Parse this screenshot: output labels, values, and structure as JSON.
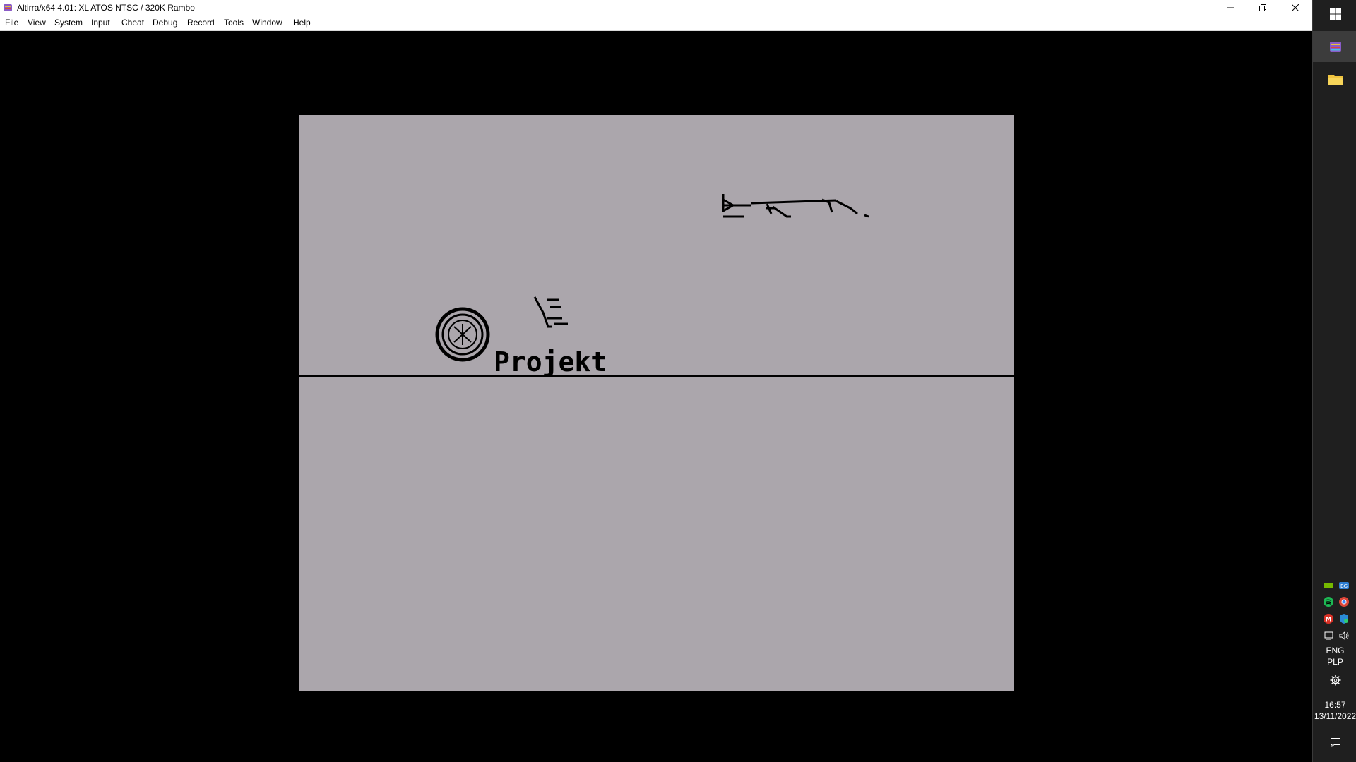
{
  "window": {
    "title": "Altirra/x64 4.01: XL ATOS NTSC / 320K Rambo"
  },
  "menu": [
    "File",
    "View",
    "System",
    "Input",
    "Cheat",
    "Debug",
    "Record",
    "Tools",
    "Window",
    "Help"
  ],
  "screen": {
    "background_color": "#aba6ac",
    "label_text": "Projekt"
  },
  "taskbar": {
    "language_line1": "ENG",
    "language_line2": "PLP",
    "time": "16:57",
    "date": "13/11/2022"
  },
  "colors": {
    "taskbar_bg": "#1f1f1f",
    "window_bg": "#000000",
    "folder_icon": "#f0c43f",
    "spotify": "#1db954"
  }
}
